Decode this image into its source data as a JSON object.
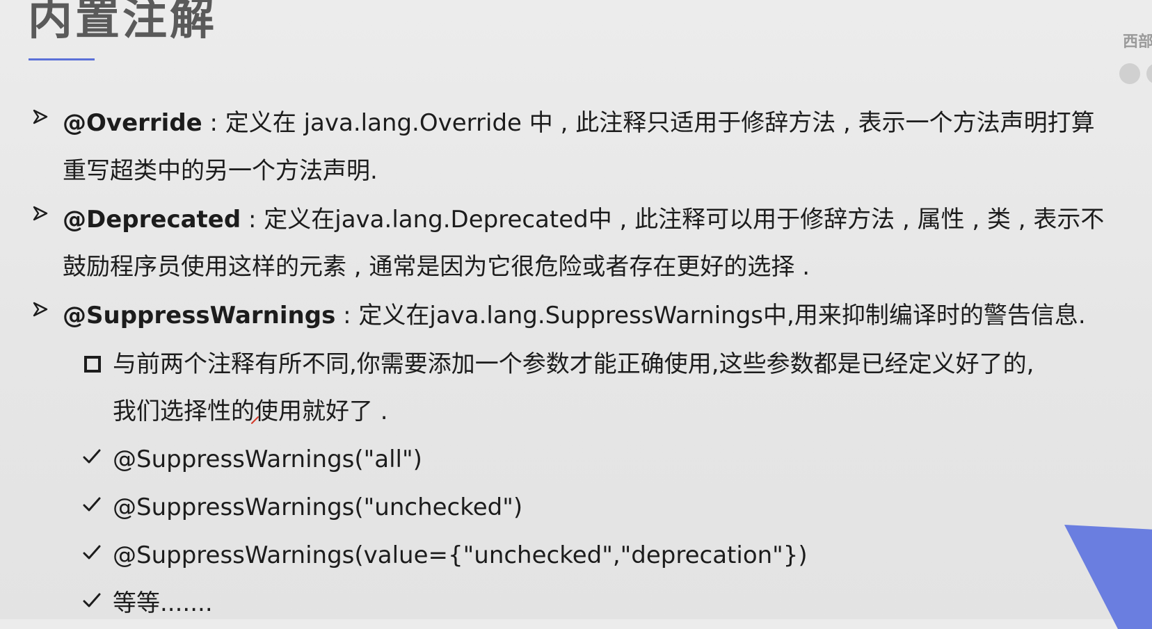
{
  "slide": {
    "title": "内置注解",
    "corner_label": "西部"
  },
  "bullets": [
    {
      "keyword": "@Override",
      "line1": " : 定义在 java.lang.Override 中 , 此注释只适用于修辞方法 , 表示一个方法声明打算",
      "line2": "重写超类中的另一个方法声明."
    },
    {
      "keyword": "@Deprecated",
      "line1": " : 定义在java.lang.Deprecated中 , 此注释可以用于修辞方法 , 属性 , 类 , 表示不",
      "line2": "鼓励程序员使用这样的元素 , 通常是因为它很危险或者存在更好的选择 ."
    },
    {
      "keyword": "@SuppressWarnings",
      "line1": " : 定义在java.lang.SuppressWarnings中,用来抑制编译时的警告信息."
    }
  ],
  "sub_note": {
    "line1": "与前两个注释有所不同,你需要添加一个参数才能正确使用,这些参数都是已经定义好了的,",
    "line2": "我们选择性的使用就好了 ."
  },
  "checks": [
    "@SuppressWarnings(\"all\")",
    "@SuppressWarnings(\"unchecked\")",
    "@SuppressWarnings(value={\"unchecked\",\"deprecation\"})",
    "等等......."
  ],
  "colors": {
    "accent": "#5b70d8",
    "triangle": "#6a7ee0",
    "title": "#5a5a5a"
  }
}
